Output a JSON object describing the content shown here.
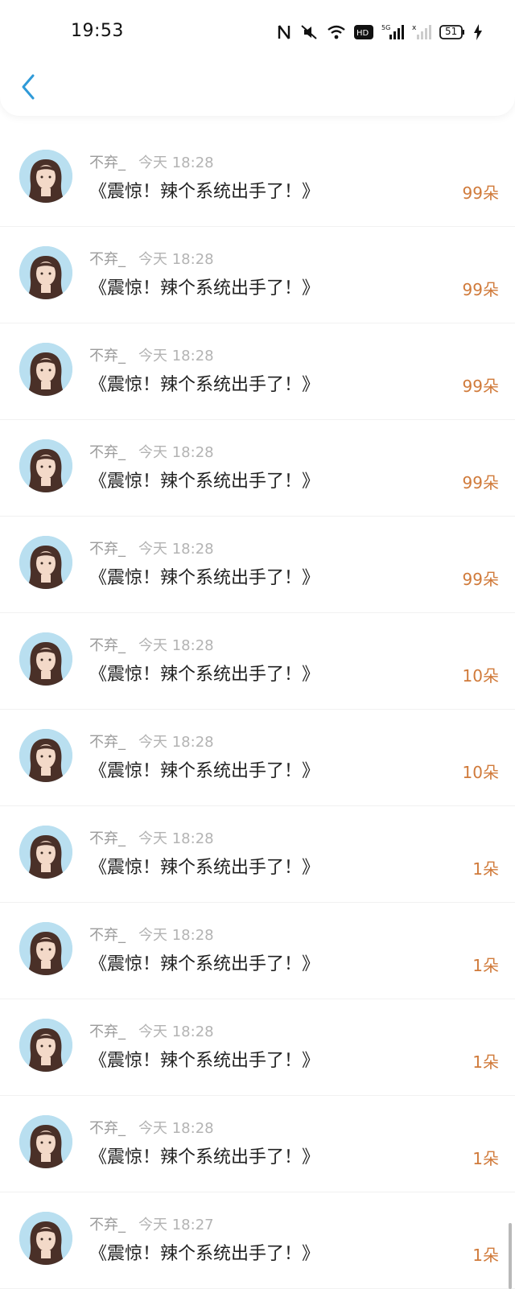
{
  "status_bar": {
    "time": "19:53",
    "battery": "51",
    "icons": [
      "nfc-icon",
      "mute-icon",
      "wifi-icon",
      "hd-icon",
      "5g-signal-icon",
      "signal-icon",
      "battery-icon",
      "charging-icon"
    ]
  },
  "header": {
    "back_icon": "chevron-left-icon"
  },
  "items": [
    {
      "username": "不弃_",
      "time": "今天 18:28",
      "title": "《震惊！辣个系统出手了！》",
      "gift": "99朵"
    },
    {
      "username": "不弃_",
      "time": "今天 18:28",
      "title": "《震惊！辣个系统出手了！》",
      "gift": "99朵"
    },
    {
      "username": "不弃_",
      "time": "今天 18:28",
      "title": "《震惊！辣个系统出手了！》",
      "gift": "99朵"
    },
    {
      "username": "不弃_",
      "time": "今天 18:28",
      "title": "《震惊！辣个系统出手了！》",
      "gift": "99朵"
    },
    {
      "username": "不弃_",
      "time": "今天 18:28",
      "title": "《震惊！辣个系统出手了！》",
      "gift": "99朵"
    },
    {
      "username": "不弃_",
      "time": "今天 18:28",
      "title": "《震惊！辣个系统出手了！》",
      "gift": "10朵"
    },
    {
      "username": "不弃_",
      "time": "今天 18:28",
      "title": "《震惊！辣个系统出手了！》",
      "gift": "10朵"
    },
    {
      "username": "不弃_",
      "time": "今天 18:28",
      "title": "《震惊！辣个系统出手了！》",
      "gift": "1朵"
    },
    {
      "username": "不弃_",
      "time": "今天 18:28",
      "title": "《震惊！辣个系统出手了！》",
      "gift": "1朵"
    },
    {
      "username": "不弃_",
      "time": "今天 18:28",
      "title": "《震惊！辣个系统出手了！》",
      "gift": "1朵"
    },
    {
      "username": "不弃_",
      "time": "今天 18:28",
      "title": "《震惊！辣个系统出手了！》",
      "gift": "1朵"
    },
    {
      "username": "不弃_",
      "time": "今天 18:27",
      "title": "《震惊！辣个系统出手了！》",
      "gift": "1朵"
    }
  ],
  "colors": {
    "accent_blue": "#2f9ad8",
    "gift_orange": "#d07a3a",
    "meta_gray": "#9b9b9b",
    "title_text": "#222222"
  }
}
